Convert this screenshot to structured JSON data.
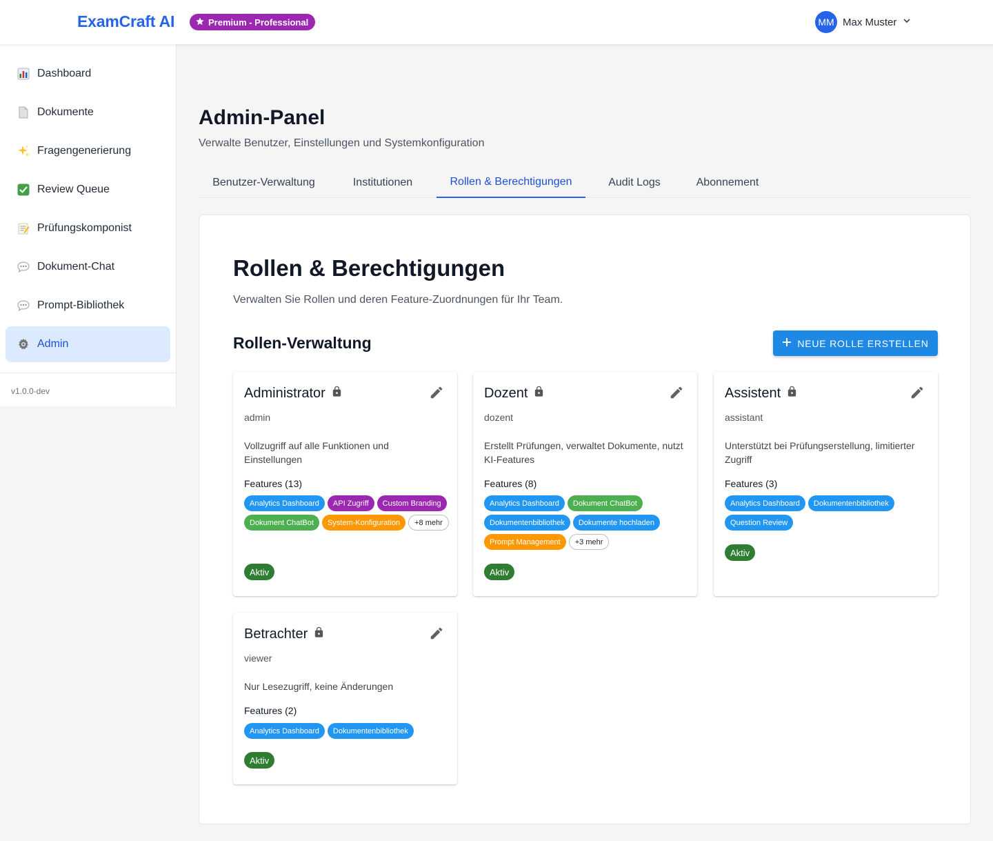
{
  "header": {
    "brand": "ExamCraft AI",
    "plan_badge": "Premium - Professional",
    "user": {
      "initials": "MM",
      "name": "Max Muster"
    }
  },
  "sidebar": {
    "items": [
      {
        "label": "Dashboard",
        "icon": "bar-chart-emoji"
      },
      {
        "label": "Dokumente",
        "icon": "document-page-emoji"
      },
      {
        "label": "Fragengenerierung",
        "icon": "sparkles-emoji"
      },
      {
        "label": "Review Queue",
        "icon": "check-mark-button-emoji"
      },
      {
        "label": "Prüfungskomponist",
        "icon": "memo-emoji"
      },
      {
        "label": "Dokument-Chat",
        "icon": "speech-balloon-emoji"
      },
      {
        "label": "Prompt-Bibliothek",
        "icon": "speech-balloon-emoji"
      },
      {
        "label": "Admin",
        "icon": "gear-emoji",
        "active": true
      }
    ],
    "version": "v1.0.0-dev"
  },
  "page": {
    "title": "Admin-Panel",
    "subtitle": "Verwalte Benutzer, Einstellungen und Systemkonfiguration",
    "tabs": [
      {
        "label": "Benutzer-Verwaltung"
      },
      {
        "label": "Institutionen"
      },
      {
        "label": "Rollen & Berechtigungen",
        "active": true
      },
      {
        "label": "Audit Logs"
      },
      {
        "label": "Abonnement"
      }
    ]
  },
  "roles_section": {
    "title": "Rollen & Berechtigungen",
    "subtitle": "Verwalten Sie Rollen und deren Feature-Zuordnungen für Ihr Team.",
    "heading": "Rollen-Verwaltung",
    "new_button": "NEUE ROLLE ERSTELLEN",
    "roles": [
      {
        "name": "Administrator",
        "key": "admin",
        "description": "Vollzugriff auf alle Funktionen und Einstellungen",
        "features_label": "Features (13)",
        "chips": [
          {
            "label": "Analytics Dashboard",
            "color": "#2196f3"
          },
          {
            "label": "API Zugriff",
            "color": "#9c27b0"
          },
          {
            "label": "Custom Branding",
            "color": "#9c27b0"
          },
          {
            "label": "Dokument ChatBot",
            "color": "#4caf50"
          },
          {
            "label": "System-Konfiguration",
            "color": "#ff9800"
          },
          {
            "label": "+8 mehr",
            "color": "outline"
          }
        ],
        "status": "Aktiv"
      },
      {
        "name": "Dozent",
        "key": "dozent",
        "description": "Erstellt Prüfungen, verwaltet Dokumente, nutzt KI-Features",
        "features_label": "Features (8)",
        "chips": [
          {
            "label": "Analytics Dashboard",
            "color": "#2196f3"
          },
          {
            "label": "Dokument ChatBot",
            "color": "#4caf50"
          },
          {
            "label": "Dokumentenbibliothek",
            "color": "#2196f3"
          },
          {
            "label": "Dokumente hochladen",
            "color": "#2196f3"
          },
          {
            "label": "Prompt Management",
            "color": "#ff9800"
          },
          {
            "label": "+3 mehr",
            "color": "outline"
          }
        ],
        "status": "Aktiv"
      },
      {
        "name": "Assistent",
        "key": "assistant",
        "description": "Unterstützt bei Prüfungserstellung, limitierter Zugriff",
        "features_label": "Features (3)",
        "chips": [
          {
            "label": "Analytics Dashboard",
            "color": "#2196f3"
          },
          {
            "label": "Dokumentenbibliothek",
            "color": "#2196f3"
          },
          {
            "label": "Question Review",
            "color": "#2196f3"
          }
        ],
        "status": "Aktiv"
      },
      {
        "name": "Betrachter",
        "key": "viewer",
        "description": "Nur Lesezugriff, keine Änderungen",
        "features_label": "Features (2)",
        "chips": [
          {
            "label": "Analytics Dashboard",
            "color": "#2196f3"
          },
          {
            "label": "Dokumentenbibliothek",
            "color": "#2196f3"
          }
        ],
        "status": "Aktiv"
      }
    ]
  },
  "colors": {
    "accent": "#2563eb",
    "active_nav_bg": "#dbeafe",
    "primary_button": "#1e88e5",
    "status_active": "#2e7d32"
  }
}
